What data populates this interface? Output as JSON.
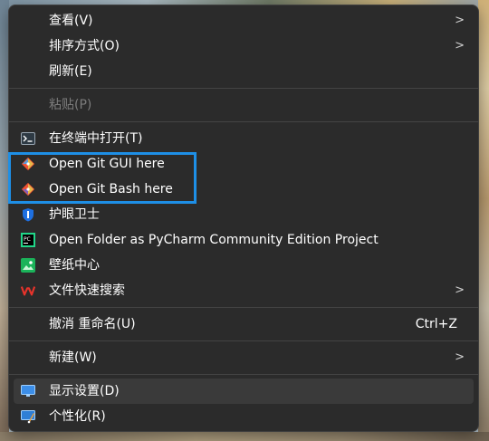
{
  "menu": {
    "items": [
      {
        "label": "查看(V)",
        "icon": "view-icon",
        "submenu": true
      },
      {
        "label": "排序方式(O)",
        "icon": "sort-icon",
        "submenu": true
      },
      {
        "label": "刷新(E)",
        "icon": "refresh-icon"
      },
      {
        "label": "粘贴(P)",
        "icon": "paste-icon",
        "disabled": true
      },
      {
        "label": "在终端中打开(T)",
        "icon": "terminal-icon"
      },
      {
        "label": "Open Git GUI here",
        "icon": "git-gui-icon"
      },
      {
        "label": "Open Git Bash here",
        "icon": "git-bash-icon"
      },
      {
        "label": "护眼卫士",
        "icon": "eye-guard-icon"
      },
      {
        "label": "Open Folder as PyCharm Community Edition Project",
        "icon": "pycharm-icon"
      },
      {
        "label": "壁纸中心",
        "icon": "wallpaper-center-icon"
      },
      {
        "label": "文件快速搜索",
        "icon": "wps-search-icon",
        "submenu": true
      },
      {
        "label": "撤消 重命名(U)",
        "icon": "undo-icon",
        "shortcut": "Ctrl+Z"
      },
      {
        "label": "新建(W)",
        "icon": "new-icon",
        "submenu": true
      },
      {
        "label": "显示设置(D)",
        "icon": "display-settings-icon"
      },
      {
        "label": "个性化(R)",
        "icon": "personalize-icon"
      }
    ],
    "submenu_glyph": ">",
    "highlight_color": "#1e8fe6"
  }
}
